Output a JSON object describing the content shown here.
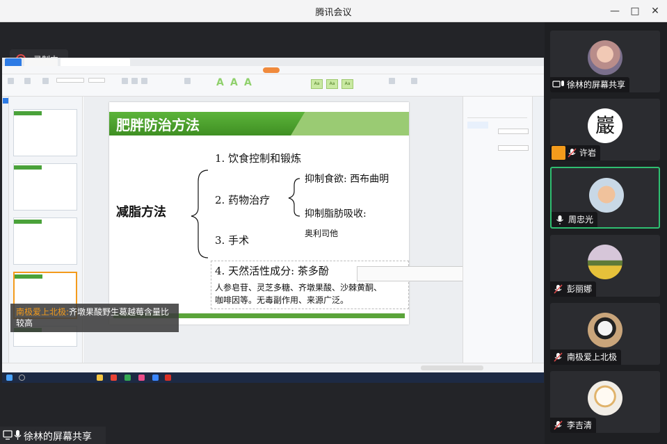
{
  "window": {
    "title": "腾讯会议"
  },
  "recording": {
    "label": "录制中"
  },
  "presenter_label": "徐林的屏幕共享",
  "live_caption": {
    "speaker": "南极爱上北极:",
    "text": "齐墩果酸野生葛越莓含量比较高"
  },
  "slide": {
    "title": "肥胖防治方法",
    "root": "减脂方法",
    "items": [
      "1. 饮食控制和锻炼",
      "2. 药物治疗",
      "3. 手术",
      "4. 天然活性成分: 茶多酚"
    ],
    "sub1": "抑制食欲: 西布曲明",
    "sub2": "抑制脂肪吸收:",
    "sub2_drug": "奥利司他",
    "line2": "人参皂苷、灵芝多糖、齐墩果酸、沙棘黄酮、",
    "line3": "咖啡因等。无毒副作用、来源广泛。"
  },
  "participants": [
    {
      "name": "徐林的屏幕共享",
      "icon": "screen-share-icon"
    },
    {
      "name": "许岩",
      "icon": "mic-muted-icon"
    },
    {
      "name": "周忠光",
      "icon": "mic-icon"
    },
    {
      "name": "彭丽娜",
      "icon": "mic-muted-icon"
    },
    {
      "name": "南极爱上北极",
      "icon": "mic-muted-icon"
    },
    {
      "name": "李吉清",
      "icon": "mic-muted-icon"
    }
  ],
  "colors": {
    "slide_green": "#4aa23a",
    "active_speaker": "#2fbf71",
    "record_red": "#e24a4a",
    "caption_speaker": "#f39b1c"
  }
}
